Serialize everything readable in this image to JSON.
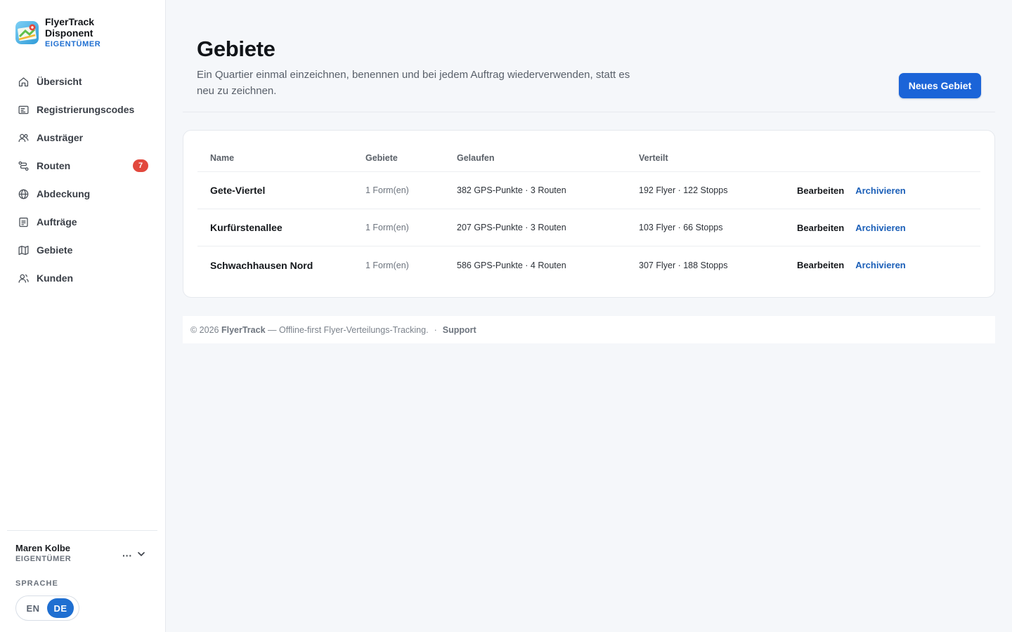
{
  "brand": {
    "name": "FlyerTrack Disponent",
    "role": "EIGENTÜMER"
  },
  "nav": {
    "items": [
      {
        "label": "Übersicht",
        "icon": "home-icon"
      },
      {
        "label": "Registrierungscodes",
        "icon": "code-card-icon"
      },
      {
        "label": "Austräger",
        "icon": "people-icon"
      },
      {
        "label": "Routen",
        "icon": "route-icon",
        "badge": "7"
      },
      {
        "label": "Abdeckung",
        "icon": "globe-icon"
      },
      {
        "label": "Aufträge",
        "icon": "document-icon"
      },
      {
        "label": "Gebiete",
        "icon": "map-icon"
      },
      {
        "label": "Kunden",
        "icon": "customers-icon"
      }
    ]
  },
  "user": {
    "name": "Maren Kolbe",
    "role": "EIGENTÜMER",
    "menu": "···"
  },
  "language": {
    "label": "SPRACHE",
    "options": [
      "EN",
      "DE"
    ],
    "selected": "DE"
  },
  "page": {
    "title": "Gebiete",
    "subtitle": "Ein Quartier einmal einzeichnen, benennen und bei jedem Auftrag wiederverwenden, statt es neu zu zeichnen.",
    "primary_button": "Neues Gebiet"
  },
  "table": {
    "columns": [
      "Name",
      "Gebiete",
      "Gelaufen",
      "Verteilt"
    ],
    "rows": [
      {
        "name": "Gete-Viertel",
        "gebiete": "1 Form(en)",
        "gelaufen": "382 GPS-Punkte · 3 Routen",
        "verteilt": "192 Flyer · 122 Stopps",
        "edit": "Bearbeiten",
        "archive": "Archivieren"
      },
      {
        "name": "Kurfürstenallee",
        "gebiete": "1 Form(en)",
        "gelaufen": "207 GPS-Punkte · 3 Routen",
        "verteilt": "103 Flyer · 66 Stopps",
        "edit": "Bearbeiten",
        "archive": "Archivieren"
      },
      {
        "name": "Schwachhausen Nord",
        "gebiete": "1 Form(en)",
        "gelaufen": "586 GPS-Punkte · 4 Routen",
        "verteilt": "307 Flyer · 188 Stopps",
        "edit": "Bearbeiten",
        "archive": "Archivieren"
      }
    ]
  },
  "footer": {
    "copyright": "© 2026",
    "brand": "FlyerTrack",
    "tagline": "— Offline-first Flyer-Verteilungs-Tracking.",
    "separator": "·",
    "support": "Support"
  },
  "colors": {
    "accent": "#1b64d8",
    "badge": "#e2483d",
    "link": "#1b5fb8"
  }
}
